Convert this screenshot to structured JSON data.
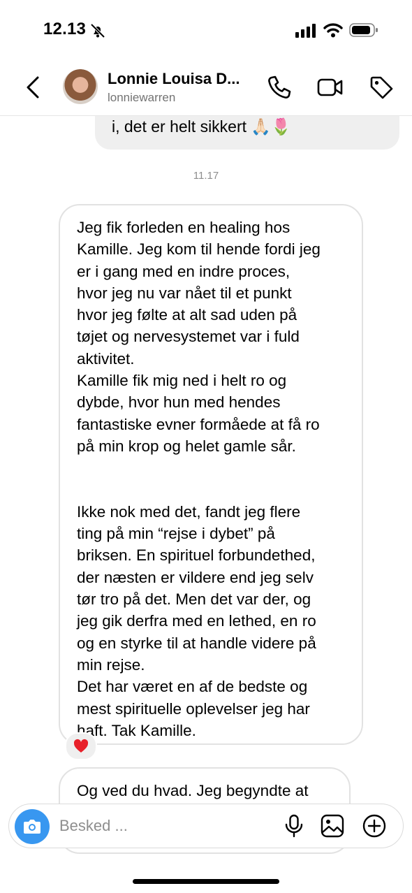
{
  "status_bar": {
    "time": "12.13"
  },
  "header": {
    "name": "Lonnie Louisa D...",
    "username": "lonniewarren"
  },
  "messages": {
    "previous_snippet": "i, det er helt sikkert 🙏🏻🌷",
    "timestamp": "11.17",
    "message_1": "Jeg fik forleden en healing hos\nKamille. Jeg kom til hende fordi jeg\ner i gang med en indre proces,\nhvor jeg nu var nået til et punkt\nhvor jeg følte at alt sad uden på\ntøjet og nervesystemet var i fuld\naktivitet.\nKamille fik mig ned i helt ro og\ndybde, hvor hun med hendes\nfantastiske evner formåede at få ro\npå min krop og helet gamle sår.\n\n\nIkke nok med det, fandt jeg flere\nting på min “rejse i dybet” på\nbriksen. En spirituel forbundethed,\nder næsten er vildere end jeg selv\ntør tro på det. Men det var der, og\njeg gik derfra med en lethed, en ro\nog en styrke til at handle videre på\nmin rejse.\nDet har været en af de bedste og\nmest spirituelle oplevelser jeg har\nhaft. Tak Kamille.",
    "message_1_reaction": "❤️",
    "message_2": "Og ved du hvad. Jeg begyndte at"
  },
  "composer": {
    "placeholder": "Besked ..."
  },
  "icons": {
    "back": "chevron-left-icon",
    "call": "phone-icon",
    "video": "video-camera-icon",
    "tag": "tag-icon",
    "camera": "camera-icon",
    "mic": "microphone-icon",
    "gallery": "image-icon",
    "add": "plus-circle-icon"
  },
  "colors": {
    "accent": "#3897f0",
    "bubble_gray": "#efefef",
    "muted_text": "#8e8e8e"
  }
}
